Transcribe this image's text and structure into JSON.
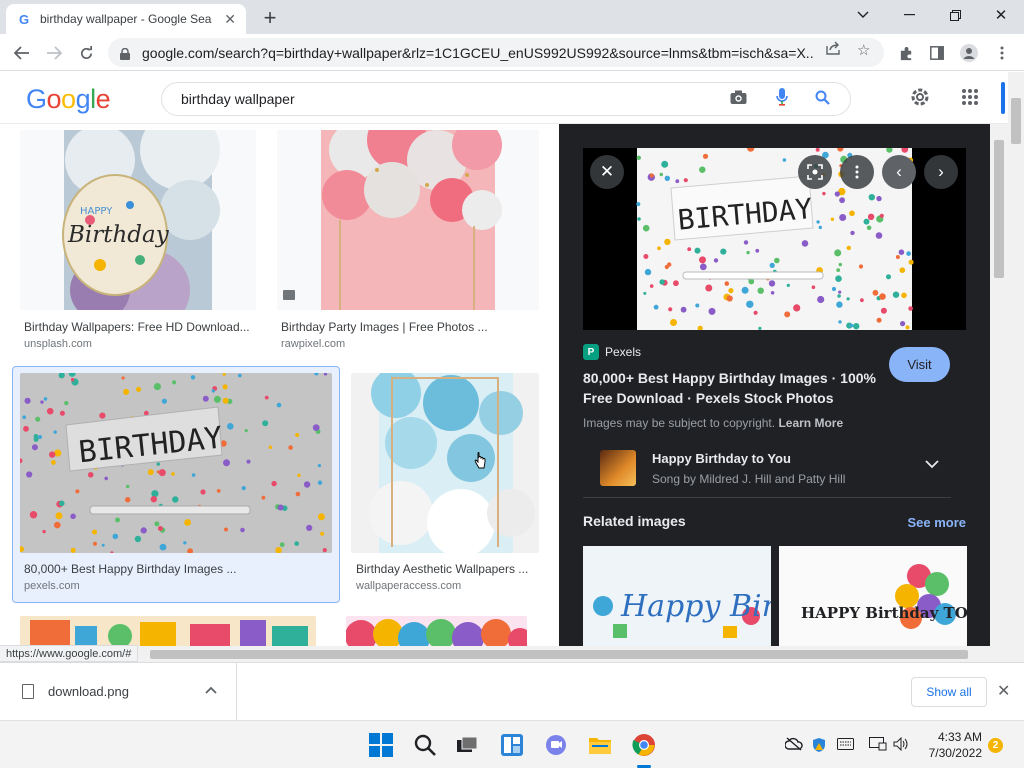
{
  "browser": {
    "tab_title": "birthday wallpaper - Google Sea",
    "url": "google.com/search?q=birthday+wallpaper&rlz=1C1GCEU_enUS992US992&source=lnms&tbm=isch&sa=X..."
  },
  "google": {
    "logo": [
      "G",
      "o",
      "o",
      "g",
      "l",
      "e"
    ],
    "logo_colors": [
      "#4285f4",
      "#ea4335",
      "#fbbc05",
      "#4285f4",
      "#34a853",
      "#ea4335"
    ],
    "query": "birthday wallpaper"
  },
  "results": [
    {
      "title": "Birthday Wallpapers: Free HD Download...",
      "site": "unsplash.com"
    },
    {
      "title": "Birthday Party Images | Free Photos ...",
      "site": "rawpixel.com"
    },
    {
      "title": "80,000+ Best Happy Birthday Images ...",
      "site": "pexels.com"
    },
    {
      "title": "Birthday Aesthetic Wallpapers ...",
      "site": "wallpaperaccess.com"
    }
  ],
  "panel": {
    "preview_text": "BIRTHDAY",
    "source_name": "Pexels",
    "source_icon": "P",
    "title": "80,000+ Best Happy Birthday Images · 100% Free Download · Pexels Stock Photos",
    "visit_label": "Visit",
    "copyright_text": "Images may be subject to copyright.",
    "learn_more": "Learn More",
    "song_title": "Happy Birthday to You",
    "song_subtitle": "Song by Mildred J. Hill and Patty Hill",
    "related_heading": "Related images",
    "see_more": "See more",
    "related_1_text": "Happy Birthday",
    "related_2_text": "HAPPY Birthday TO YOU"
  },
  "status_url": "https://www.google.com/#",
  "downloads": {
    "file_name": "download.png",
    "show_all": "Show all"
  },
  "taskbar": {
    "time": "4:33 AM",
    "date": "7/30/2022",
    "notifications": "2"
  }
}
